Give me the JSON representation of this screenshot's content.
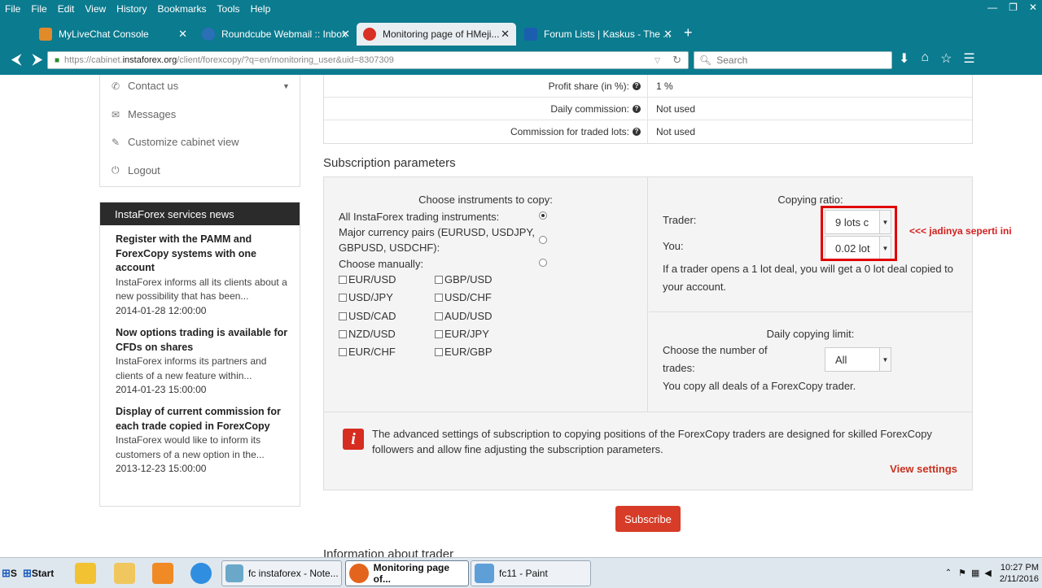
{
  "browser": {
    "menu": [
      "File",
      "File",
      "Edit",
      "View",
      "History",
      "Bookmarks",
      "Tools",
      "Help"
    ],
    "window_controls": [
      "—",
      "❐",
      "✕"
    ],
    "tabs": [
      {
        "title": "MyLiveChat Console",
        "icon_color": "#e08a2a"
      },
      {
        "title": "Roundcube Webmail :: Inbox",
        "icon_color": "#2b6fb7"
      },
      {
        "title": "Monitoring page of HMeji...",
        "icon_color": "#d93025"
      },
      {
        "title": "Forum Lists | Kaskus - The ...",
        "icon_color": "#1b5eb0"
      }
    ],
    "url_prefix": "https://cabinet.",
    "url_host": "instaforex.org",
    "url_rest": "/client/forexcopy/?q=en/monitoring_user&uid=8307309",
    "search_placeholder": "Search"
  },
  "sidebar": {
    "links": [
      {
        "label": "Contact us",
        "icon": "phone-icon"
      },
      {
        "label": "Messages",
        "icon": "envelope-icon"
      },
      {
        "label": "Customize cabinet view",
        "icon": "edit-icon"
      },
      {
        "label": "Logout",
        "icon": "power-icon"
      }
    ],
    "news_heading": "InstaForex services news",
    "news": [
      {
        "title": "Register with the PAMM and ForexCopy systems with one account",
        "body": "InstaForex informs all its clients about a new possibility that has been...",
        "date": "2014-01-28  12:00:00"
      },
      {
        "title": "Now options trading is available for CFDs on shares",
        "body": "InstaForex informs its partners and clients of a new feature within...",
        "date": "2014-01-23  15:00:00"
      },
      {
        "title": "Display of current commission for each trade copied in ForexCopy",
        "body": "InstaForex would like to inform its customers of a new option in the...",
        "date": "2013-12-23  15:00:00"
      }
    ]
  },
  "profit_table": [
    {
      "label": "Profit share (in %):",
      "value": "1 %"
    },
    {
      "label": "Daily commission:",
      "value": "Not used"
    },
    {
      "label": "Commission for traded lots:",
      "value": "Not used"
    }
  ],
  "subscription": {
    "title": "Subscription parameters",
    "instruments_heading": "Choose instruments to copy:",
    "options": [
      "All InstaForex trading instruments:",
      "Major currency pairs (EURUSD, USDJPY, GBPUSD, USDCHF):",
      "Choose manually:"
    ],
    "selected_option": 0,
    "pairs_left": [
      "EUR/USD",
      "USD/JPY",
      "USD/CAD",
      "NZD/USD",
      "EUR/CHF"
    ],
    "pairs_right": [
      "GBP/USD",
      "USD/CHF",
      "AUD/USD",
      "EUR/JPY",
      "EUR/GBP"
    ],
    "ratio_heading": "Copying ratio:",
    "trader_label": "Trader:",
    "trader_value": "9 lots c",
    "you_label": "You:",
    "you_value": "0.02 lot",
    "ratio_note": "If a trader opens a 1 lot deal, you will get a 0 lot deal copied to your account.",
    "annotation": "<<< jadinya seperti ini",
    "limit_heading": "Daily copying limit:",
    "limit_label": "Choose the number of trades:",
    "limit_value": "All",
    "limit_note": "You copy all deals of a ForexCopy trader.",
    "advanced_note": "The advanced settings of subscription to copying positions of the ForexCopy traders are designed for skilled ForexCopy followers and allow fine adjusting the subscription parameters.",
    "view_settings": "View settings",
    "subscribe": "Subscribe",
    "next_section": "Information about trader"
  },
  "taskbar": {
    "start_label": "Start",
    "s_label": "S",
    "tasks": [
      {
        "label": "fc instaforex - Note...",
        "icon_color": "#6aa7c9"
      },
      {
        "label": "Monitoring page of...",
        "icon_color": "#e3651d"
      },
      {
        "label": "fc11 - Paint",
        "icon_color": "#5f9fd8"
      }
    ],
    "time": "10:27 PM",
    "date": "2/11/2016"
  }
}
